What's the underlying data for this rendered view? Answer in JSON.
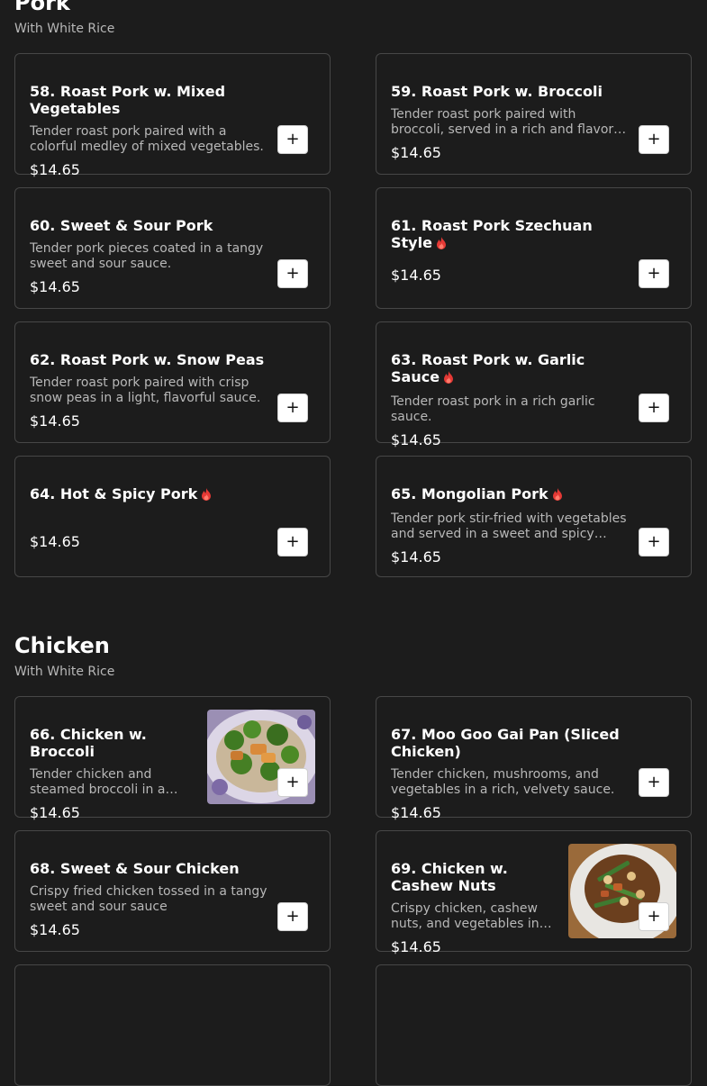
{
  "sections": [
    {
      "title": "Pork",
      "subtitle": "With White Rice"
    },
    {
      "title": "Chicken",
      "subtitle": "With White Rice"
    }
  ],
  "items": [
    {
      "name": "58. Roast Pork w. Mixed Vegetables",
      "desc": "Tender roast pork paired with a colorful medley of mixed vegetables.",
      "price": "$14.65"
    },
    {
      "name": "59. Roast Pork w. Broccoli",
      "desc": "Tender roast pork paired with broccoli, served in a rich and flavorful brown sauce.",
      "price": "$14.65"
    },
    {
      "name": "60. Sweet & Sour Pork",
      "desc": "Tender pork pieces coated in a tangy sweet and sour sauce.",
      "price": "$14.65"
    },
    {
      "name": "61. Roast Pork Szechuan Style",
      "desc": "",
      "price": "$14.65",
      "spicy": true
    },
    {
      "name": "62. Roast Pork w. Snow Peas",
      "desc": "Tender roast pork paired with crisp snow peas in a light, flavorful sauce.",
      "price": "$14.65"
    },
    {
      "name": "63. Roast Pork w. Garlic Sauce",
      "desc": "Tender roast pork in a rich garlic sauce.",
      "price": "$14.65",
      "spicy": true
    },
    {
      "name": "64. Hot & Spicy Pork",
      "desc": "",
      "price": "$14.65",
      "spicy": true
    },
    {
      "name": "65. Mongolian Pork",
      "desc": "Tender pork stir-fried with vegetables and served in a sweet and spicy sauce.",
      "price": "$14.65",
      "spicy": true
    },
    {
      "name": "66. Chicken w. Broccoli",
      "desc": "Tender chicken and steamed broccoli in a savory brown sauce.",
      "price": "$14.65",
      "image": "chicken-broccoli-photo"
    },
    {
      "name": "67. Moo Goo Gai Pan (Sliced Chicken)",
      "desc": "Tender chicken, mushrooms, and vegetables in a rich, velvety sauce.",
      "price": "$14.65"
    },
    {
      "name": "68. Sweet & Sour Chicken",
      "desc": "Crispy fried chicken tossed in a tangy sweet and sour sauce",
      "price": "$14.65"
    },
    {
      "name": "69. Chicken w. Cashew Nuts",
      "desc": "Crispy chicken, cashew nuts, and vegetables in a savory sauce.",
      "price": "$14.65",
      "image": "cashew-chicken-photo"
    }
  ],
  "add_label": "+",
  "colors": {
    "background": "#1c1c1c",
    "card_border": "#474747",
    "spicy": "#e53935",
    "muted_text": "#b8b8b8"
  }
}
